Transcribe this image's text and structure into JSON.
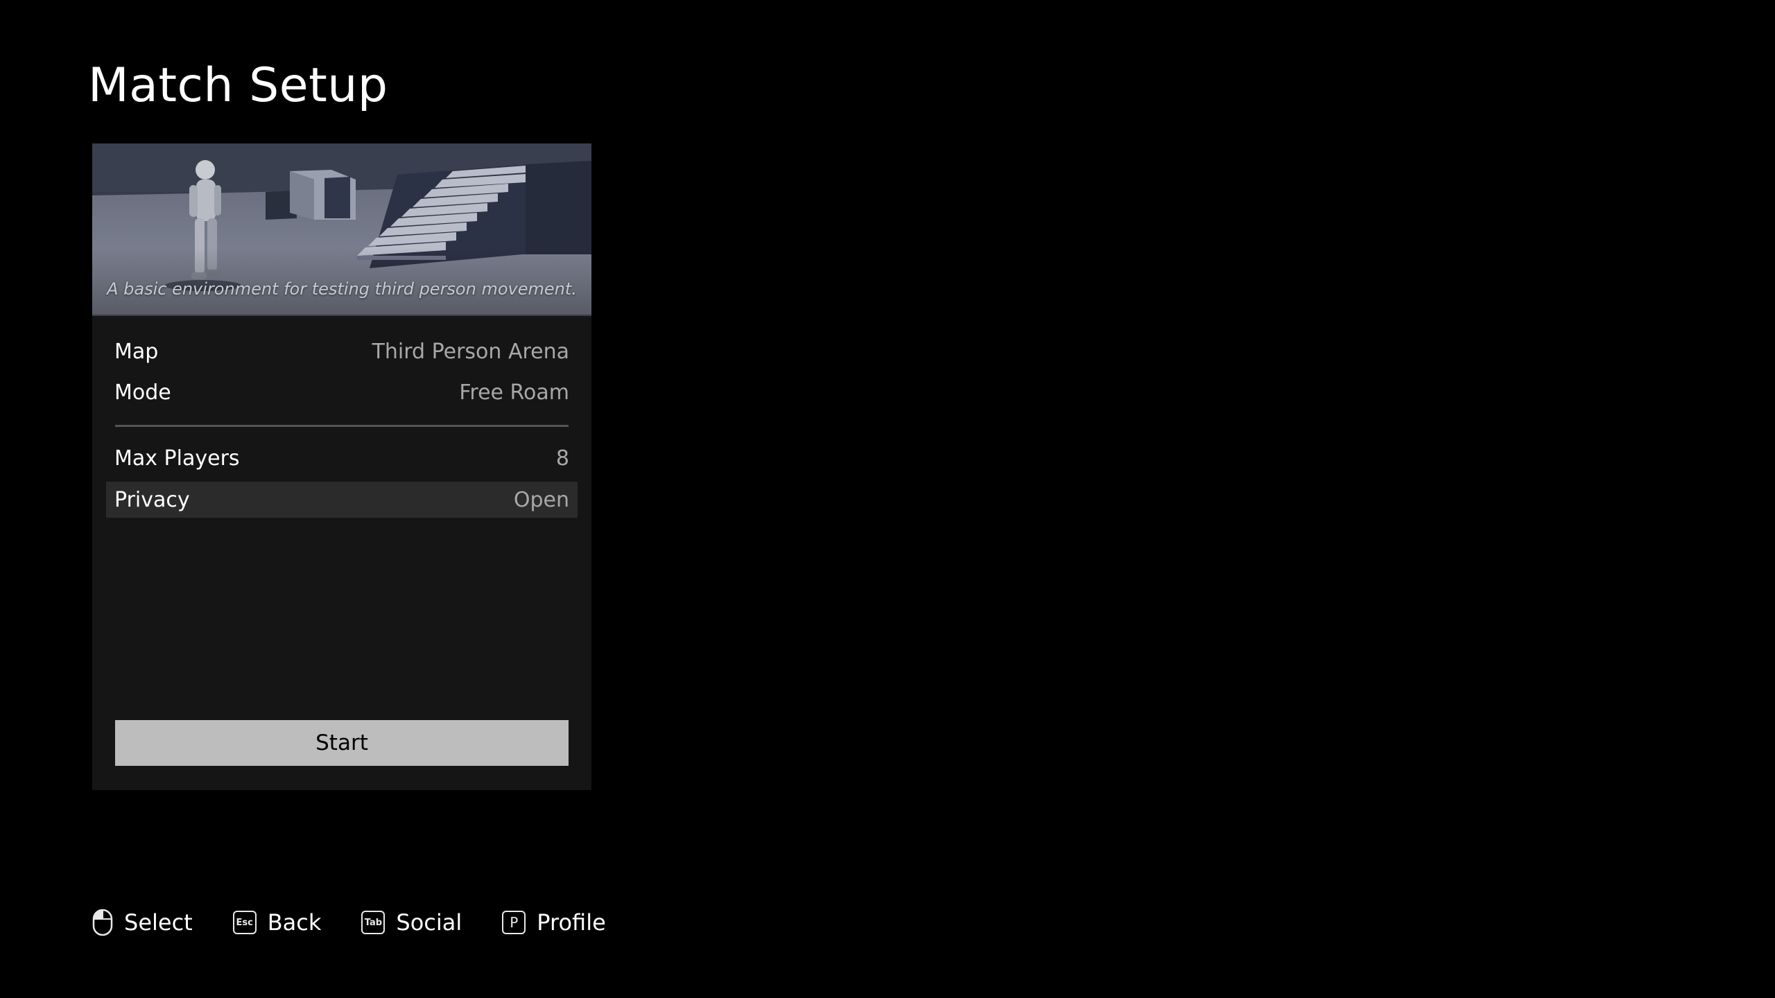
{
  "screen": {
    "title": "Match Setup"
  },
  "preview": {
    "caption": "A basic environment for testing third person movement."
  },
  "settings": {
    "rows": [
      {
        "label": "Map",
        "value": "Third Person Arena"
      },
      {
        "label": "Mode",
        "value": "Free Roam"
      },
      {
        "label": "Max Players",
        "value": "8"
      },
      {
        "label": "Privacy",
        "value": "Open"
      }
    ],
    "highlighted_row": "Privacy"
  },
  "start_button": {
    "label": "Start"
  },
  "hints": [
    {
      "icon": "mouse-left-click-icon",
      "key": "",
      "label": "Select"
    },
    {
      "icon": "esc-key-icon",
      "key": "Esc",
      "label": "Back"
    },
    {
      "icon": "tab-key-icon",
      "key": "Tab",
      "label": "Social"
    },
    {
      "icon": "p-key-icon",
      "key": "P",
      "label": "Profile"
    }
  ],
  "colors": {
    "background": "#000000",
    "panel": "#151515",
    "highlight_row": "#2b2b2b",
    "button": "#bdbdbd",
    "value_text": "#a8a8a8"
  }
}
